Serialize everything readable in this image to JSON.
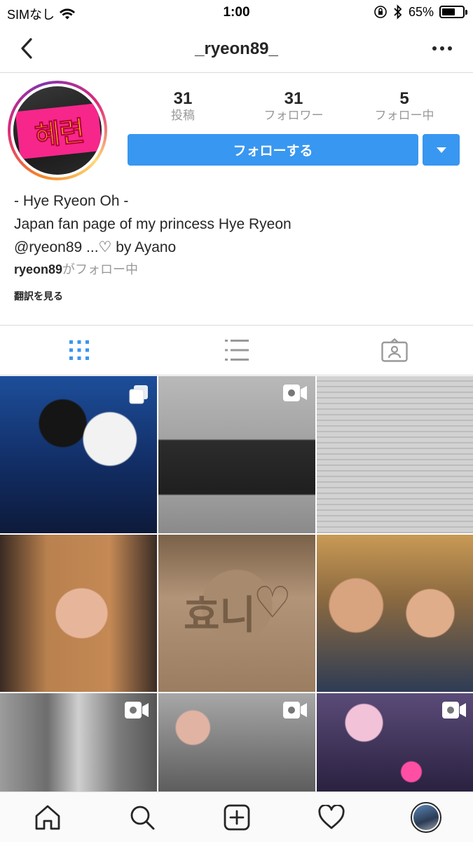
{
  "status_bar": {
    "carrier": "SIMなし",
    "time": "1:00",
    "battery_percent": "65%",
    "battery_level": 0.65,
    "icons": [
      "wifi-icon",
      "orientation-lock-icon",
      "bluetooth-icon",
      "battery-icon"
    ]
  },
  "nav": {
    "title": "_ryeon89_",
    "back_icon": "chevron-left-icon",
    "more_icon": "more-horizontal-icon"
  },
  "profile": {
    "avatar_text": "혜련",
    "stats": [
      {
        "value": "31",
        "label": "投稿"
      },
      {
        "value": "31",
        "label": "フォロワー"
      },
      {
        "value": "5",
        "label": "フォロー中"
      }
    ],
    "follow_button": "フォローする",
    "bio_lines": [
      "- Hye Ryeon Oh -",
      "Japan fan page of my princess Hye Ryeon",
      "@ryeon89 ...♡ by Ayano"
    ],
    "followed_by_user": "ryeon89",
    "followed_by_suffix": "がフォロー中",
    "translate_link": "翻訳を見る"
  },
  "tabs": [
    "grid-icon",
    "list-icon",
    "tagged-icon"
  ],
  "grid": {
    "sand_text": "효니",
    "sand_heart": "♡",
    "posts": [
      {
        "type": "carousel"
      },
      {
        "type": "video"
      },
      {
        "type": "photo"
      },
      {
        "type": "photo"
      },
      {
        "type": "photo"
      },
      {
        "type": "photo"
      },
      {
        "type": "video"
      },
      {
        "type": "video"
      },
      {
        "type": "video"
      }
    ]
  },
  "bottom_bar": [
    "home-icon",
    "search-icon",
    "add-icon",
    "heart-icon",
    "profile-avatar"
  ],
  "colors": {
    "accent": "#3897f0",
    "text": "#262626",
    "secondary": "#999999",
    "divider": "#dbdbdb"
  }
}
